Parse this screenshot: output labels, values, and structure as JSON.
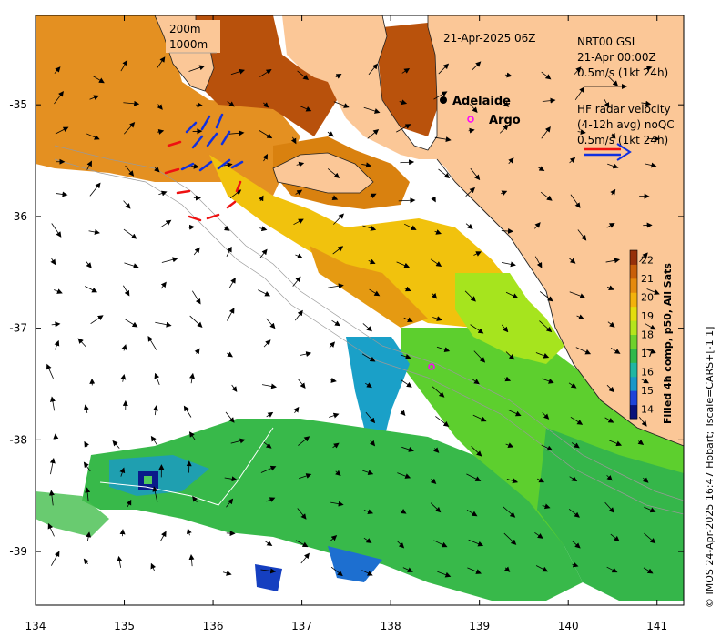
{
  "timestamp": "21-Apr-2025 06Z",
  "isobaths": [
    "200m",
    "1000m"
  ],
  "model_block": {
    "lines": [
      "NRT00 GSL",
      "21-Apr 00:00Z",
      "0.5m/s (1kt 24h)"
    ]
  },
  "radar_block": {
    "lines": [
      "HF radar velocity",
      "(4-12h avg) noQC",
      "0.5m/s (1kt 24h)"
    ]
  },
  "places": [
    {
      "name": "Adelaide",
      "lon": 138.5,
      "lat": -34.93
    },
    {
      "name": "Argo",
      "lon": 138.83,
      "lat": -35.11
    }
  ],
  "argo_float": {
    "lon": 138.47,
    "lat": -37.34
  },
  "axes": {
    "lon_ticks": [
      "134",
      "135",
      "136",
      "137",
      "138",
      "139",
      "140",
      "141"
    ],
    "lat_ticks": [
      "-35",
      "-36",
      "-37",
      "-38",
      "-39"
    ],
    "lon_range": [
      134.0,
      141.3
    ],
    "lat_range": [
      -39.48,
      -34.2
    ]
  },
  "colorbar": {
    "label": "Filled 4h comp, p50, All Sats",
    "ticks": [
      "22",
      "21",
      "20",
      "19",
      "18",
      "17",
      "16",
      "15",
      "14"
    ],
    "range": [
      13.5,
      22.5
    ],
    "colors": [
      "#08117a",
      "#1d43d8",
      "#1a97c9",
      "#21b6a2",
      "#31b84b",
      "#6fd12c",
      "#b5e51c",
      "#e3dd0d",
      "#f3b20b",
      "#e58a0d",
      "#c95f0a",
      "#96300a"
    ]
  },
  "credit": "© IMOS 24-Apr-2025 16:47 Hobart; Tscale=CARS+[-1 1]",
  "style": {
    "land": "#fbc797",
    "ocean_blank": "#ffffff",
    "model_arrow": "#000000",
    "radar_red": "#ee1111",
    "radar_blue": "#1030e0",
    "argo": "#ff00ff"
  }
}
